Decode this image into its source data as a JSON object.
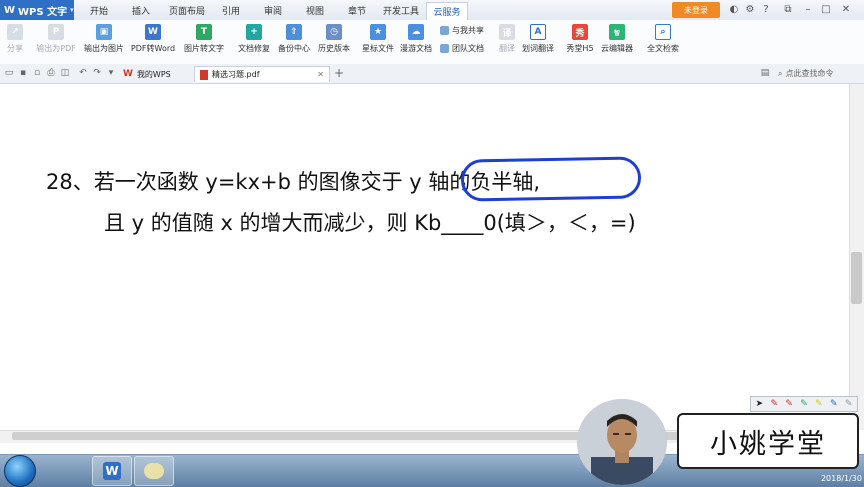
{
  "app": {
    "name": "WPS 文字",
    "tabs": [
      "开始",
      "插入",
      "页面布局",
      "引用",
      "审阅",
      "视图",
      "章节",
      "开发工具",
      "云服务"
    ],
    "active_tab": "云服务",
    "login_label": "未登录"
  },
  "ribbon": {
    "buttons": [
      {
        "label": "分享",
        "icon": "share-icon",
        "disabled": true
      },
      {
        "label": "输出为PDF",
        "icon": "pdf-export-icon",
        "disabled": true
      },
      {
        "label": "输出为图片",
        "icon": "image-export-icon",
        "disabled": false
      },
      {
        "label": "PDF转Word",
        "icon": "pdf-to-word-icon",
        "disabled": false
      },
      {
        "label": "图片转文字",
        "icon": "ocr-icon",
        "disabled": false
      },
      {
        "label": "文档修复",
        "icon": "doc-repair-icon",
        "disabled": false
      },
      {
        "label": "备份中心",
        "icon": "backup-icon",
        "disabled": false
      },
      {
        "label": "历史版本",
        "icon": "history-icon",
        "disabled": false
      },
      {
        "label": "星标文件",
        "icon": "star-file-icon",
        "disabled": false
      },
      {
        "label": "漫游文档",
        "icon": "roaming-doc-icon",
        "disabled": false
      },
      {
        "label": "翻译",
        "icon": "translate-icon",
        "disabled": true
      },
      {
        "label": "划词翻译",
        "icon": "word-translate-icon",
        "disabled": false
      },
      {
        "label": "秀堂H5",
        "icon": "h5-icon",
        "disabled": false
      },
      {
        "label": "云编辑器",
        "icon": "cloud-editor-icon",
        "disabled": false
      },
      {
        "label": "全文检索",
        "icon": "fulltext-search-icon",
        "disabled": false
      }
    ],
    "small_buttons": [
      "与我共享",
      "团队文档"
    ]
  },
  "doc_tabs": [
    {
      "label": "我的WPS",
      "active": false
    },
    {
      "label": "精选习题.pdf",
      "active": true
    }
  ],
  "command_search": "点此查找命令",
  "document": {
    "line1": "28、若一次函数 y=kx+b 的图像交于 y 轴的负半轴,",
    "line2": "且 y 的值随 x 的增大而减少，则 Kb____0(填＞，＜，=)"
  },
  "brand": "小姚学堂",
  "taskbar": {
    "date": "2018/1/30"
  },
  "colors": {
    "accent": "#2f6fc6",
    "login": "#f08a24",
    "annotation": "#1e3fd1"
  }
}
